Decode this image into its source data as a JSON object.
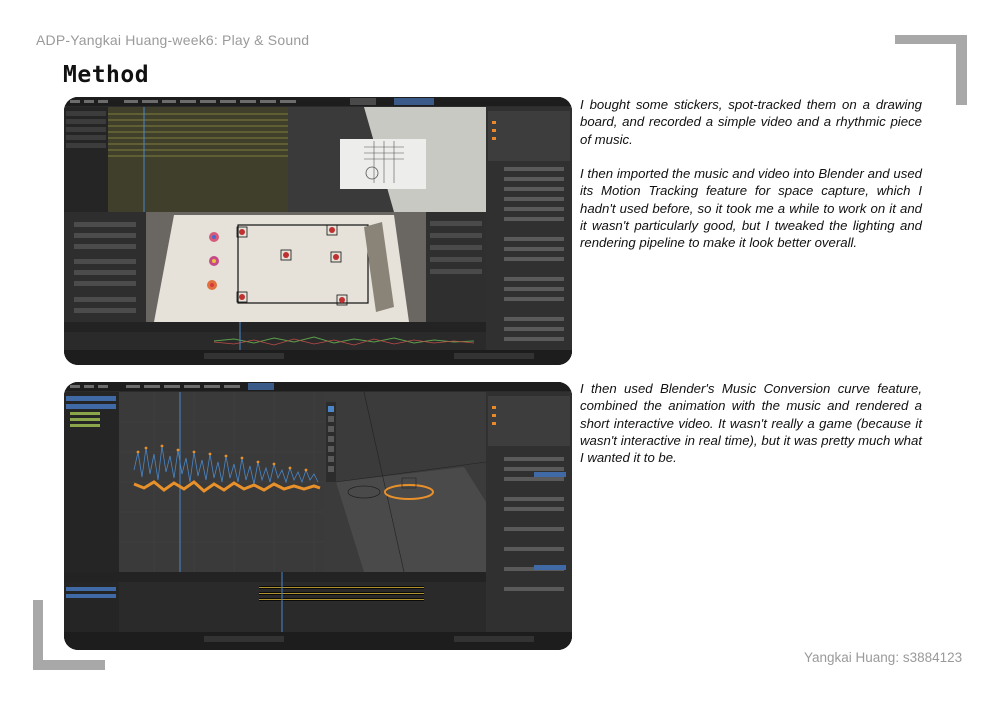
{
  "header": {
    "course_title": "ADP-Yangkai Huang-week6: Play & Sound"
  },
  "section": {
    "title": "Method"
  },
  "paragraphs": [
    "I bought some stickers, spot-tracked them on a drawing board, and recorded a simple video and a rhythmic piece of music.",
    "I then imported the music and video into Blender and used its Motion Tracking feature for space capture, which I hadn't used before, so it took me a while to work on it and it wasn't particularly good, but I tweaked the lighting and rendering pipeline to make it look better overall.",
    "I then used Blender's Music Conversion curve feature, combined the animation with the music and rendered a short interactive video. It wasn't really a game (because it wasn't interactive in real time), but it was pretty much what I wanted it to be."
  ],
  "footer": {
    "author": "Yangkai Huang: s3884123"
  },
  "screenshots": [
    {
      "name": "blender-motion-tracking",
      "app": "Blender",
      "workspace_tab": "Motion Tracking"
    },
    {
      "name": "blender-graph-editor",
      "app": "Blender",
      "workspace_tab": "Animation"
    }
  ],
  "colors": {
    "accent_gray": "#a8a8a8",
    "text_gray": "#9a9a9a",
    "blender_bg": "#2b2b2b",
    "curve_orange": "#e8902a",
    "curve_blue": "#4a86c8"
  }
}
